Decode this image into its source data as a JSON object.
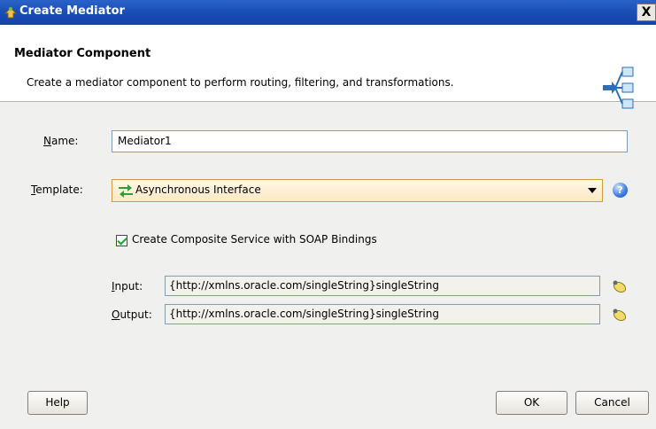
{
  "window": {
    "title": "Create Mediator",
    "close_label": "X"
  },
  "header": {
    "title": "Mediator Component",
    "description": "Create a mediator component to perform routing, filtering, and transformations."
  },
  "form": {
    "name": {
      "label_accesskey": "N",
      "label_rest": "ame:",
      "value": "Mediator1"
    },
    "template": {
      "label_accesskey": "T",
      "label_rest": "emplate:",
      "value": "Asynchronous Interface",
      "help_label": "?"
    },
    "composite_checkbox": {
      "label": "Create Composite Service with SOAP Bindings",
      "checked": true
    },
    "input": {
      "label_accesskey": "I",
      "label_rest": "nput:",
      "value": "{http://xmlns.oracle.com/singleString}singleString"
    },
    "output": {
      "label_accesskey": "O",
      "label_rest": "utput:",
      "value": "{http://xmlns.oracle.com/singleString}singleString"
    }
  },
  "buttons": {
    "help": "Help",
    "ok": "OK",
    "cancel": "Cancel"
  },
  "colors": {
    "titlebar": "#1a4fb8",
    "combo_border": "#d39a43",
    "field_border": "#7f9db9"
  }
}
